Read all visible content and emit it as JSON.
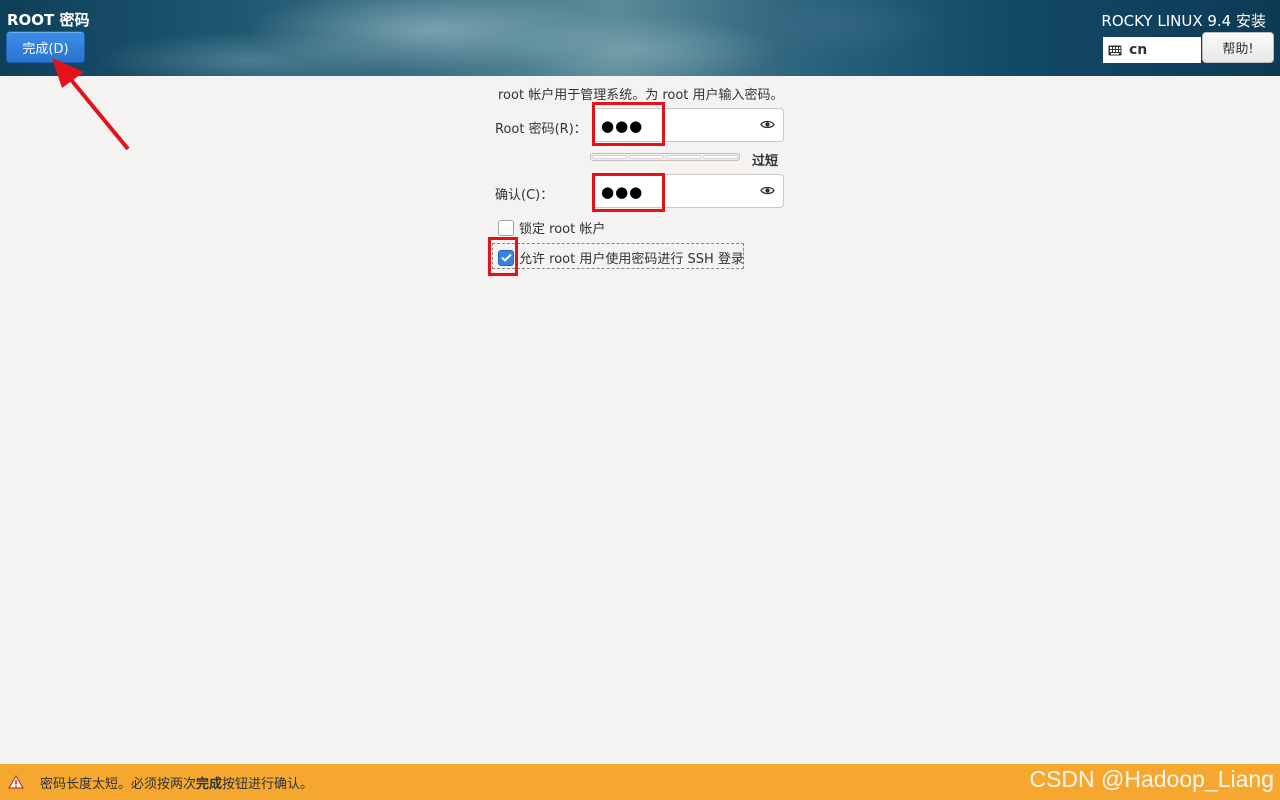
{
  "header": {
    "spoke_title": "ROOT 密码",
    "done_label": "完成(D)",
    "product_title": "ROCKY LINUX 9.4 安装",
    "keyboard_layout": "cn",
    "help_label": "帮助!"
  },
  "form": {
    "description": "root 帐户用于管理系统。为 root 用户输入密码。",
    "password_label": "Root 密码(R)：",
    "password_value": "●●●",
    "strength_text": "过短",
    "confirm_label": "确认(C)：",
    "confirm_value": "●●●",
    "lock_root_label": "锁定 root 帐户",
    "lock_root_checked": false,
    "allow_ssh_label": "允许 root 用户使用密码进行 SSH 登录",
    "allow_ssh_checked": true
  },
  "statusbar": {
    "prefix": "密码长度太短。必须按两次",
    "bold": "完成",
    "suffix": "按钮进行确认。"
  },
  "watermark": "CSDN @Hadoop_Liang",
  "colors": {
    "accent": "#3584e4",
    "status_bg": "#f6a72f",
    "highlight": "#e3121b"
  }
}
